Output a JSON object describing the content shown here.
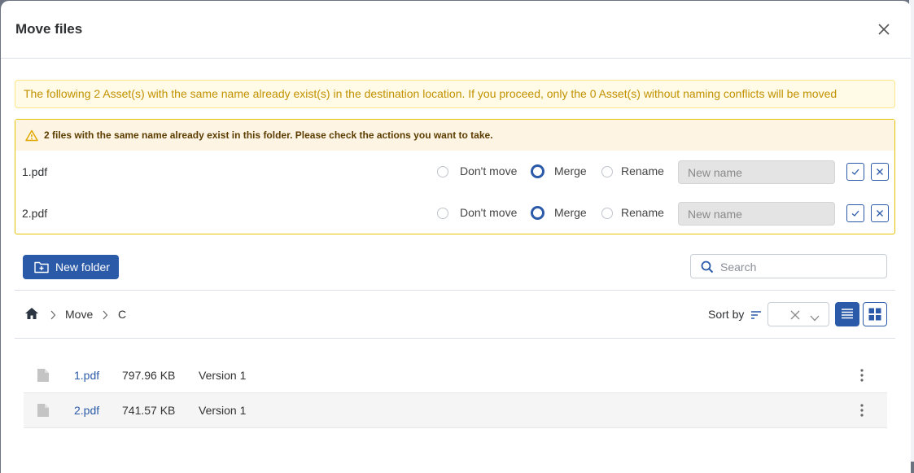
{
  "modal": {
    "title": "Move files"
  },
  "banner": {
    "text": "The following 2 Asset(s) with the same name already exist(s) in the destination location. If you proceed, only the 0 Asset(s) without naming conflicts will be moved"
  },
  "conflicts": {
    "header": "2 files with the same name already exist in this folder. Please check the actions you want to take.",
    "rows": [
      {
        "file": "1.pdf",
        "options": [
          "Don't move",
          "Merge",
          "Rename"
        ],
        "selected": "Merge",
        "new_name_placeholder": "New name"
      },
      {
        "file": "2.pdf",
        "options": [
          "Don't move",
          "Merge",
          "Rename"
        ],
        "selected": "Merge",
        "new_name_placeholder": "New name"
      }
    ]
  },
  "toolbar": {
    "new_folder_label": "New folder",
    "search_placeholder": "Search"
  },
  "breadcrumb": {
    "items": [
      "Move",
      "C"
    ]
  },
  "sort": {
    "label": "Sort by"
  },
  "files": [
    {
      "name": "1.pdf",
      "size": "797.96 KB",
      "version": "Version 1"
    },
    {
      "name": "2.pdf",
      "size": "741.57 KB",
      "version": "Version 1"
    }
  ],
  "colors": {
    "primary": "#2a5aa8",
    "warning_text": "#c29100",
    "warning_bg": "#fffbe6",
    "conflict_border": "#e6c200"
  },
  "icons": {
    "close": "close-icon",
    "warning": "warning-triangle-icon",
    "new_folder": "folder-plus-icon",
    "search": "search-icon",
    "home": "home-icon",
    "sort": "sort-lines-icon",
    "list_view": "list-view-icon",
    "grid_view": "grid-view-icon",
    "file": "file-icon",
    "more": "more-vertical-icon"
  }
}
